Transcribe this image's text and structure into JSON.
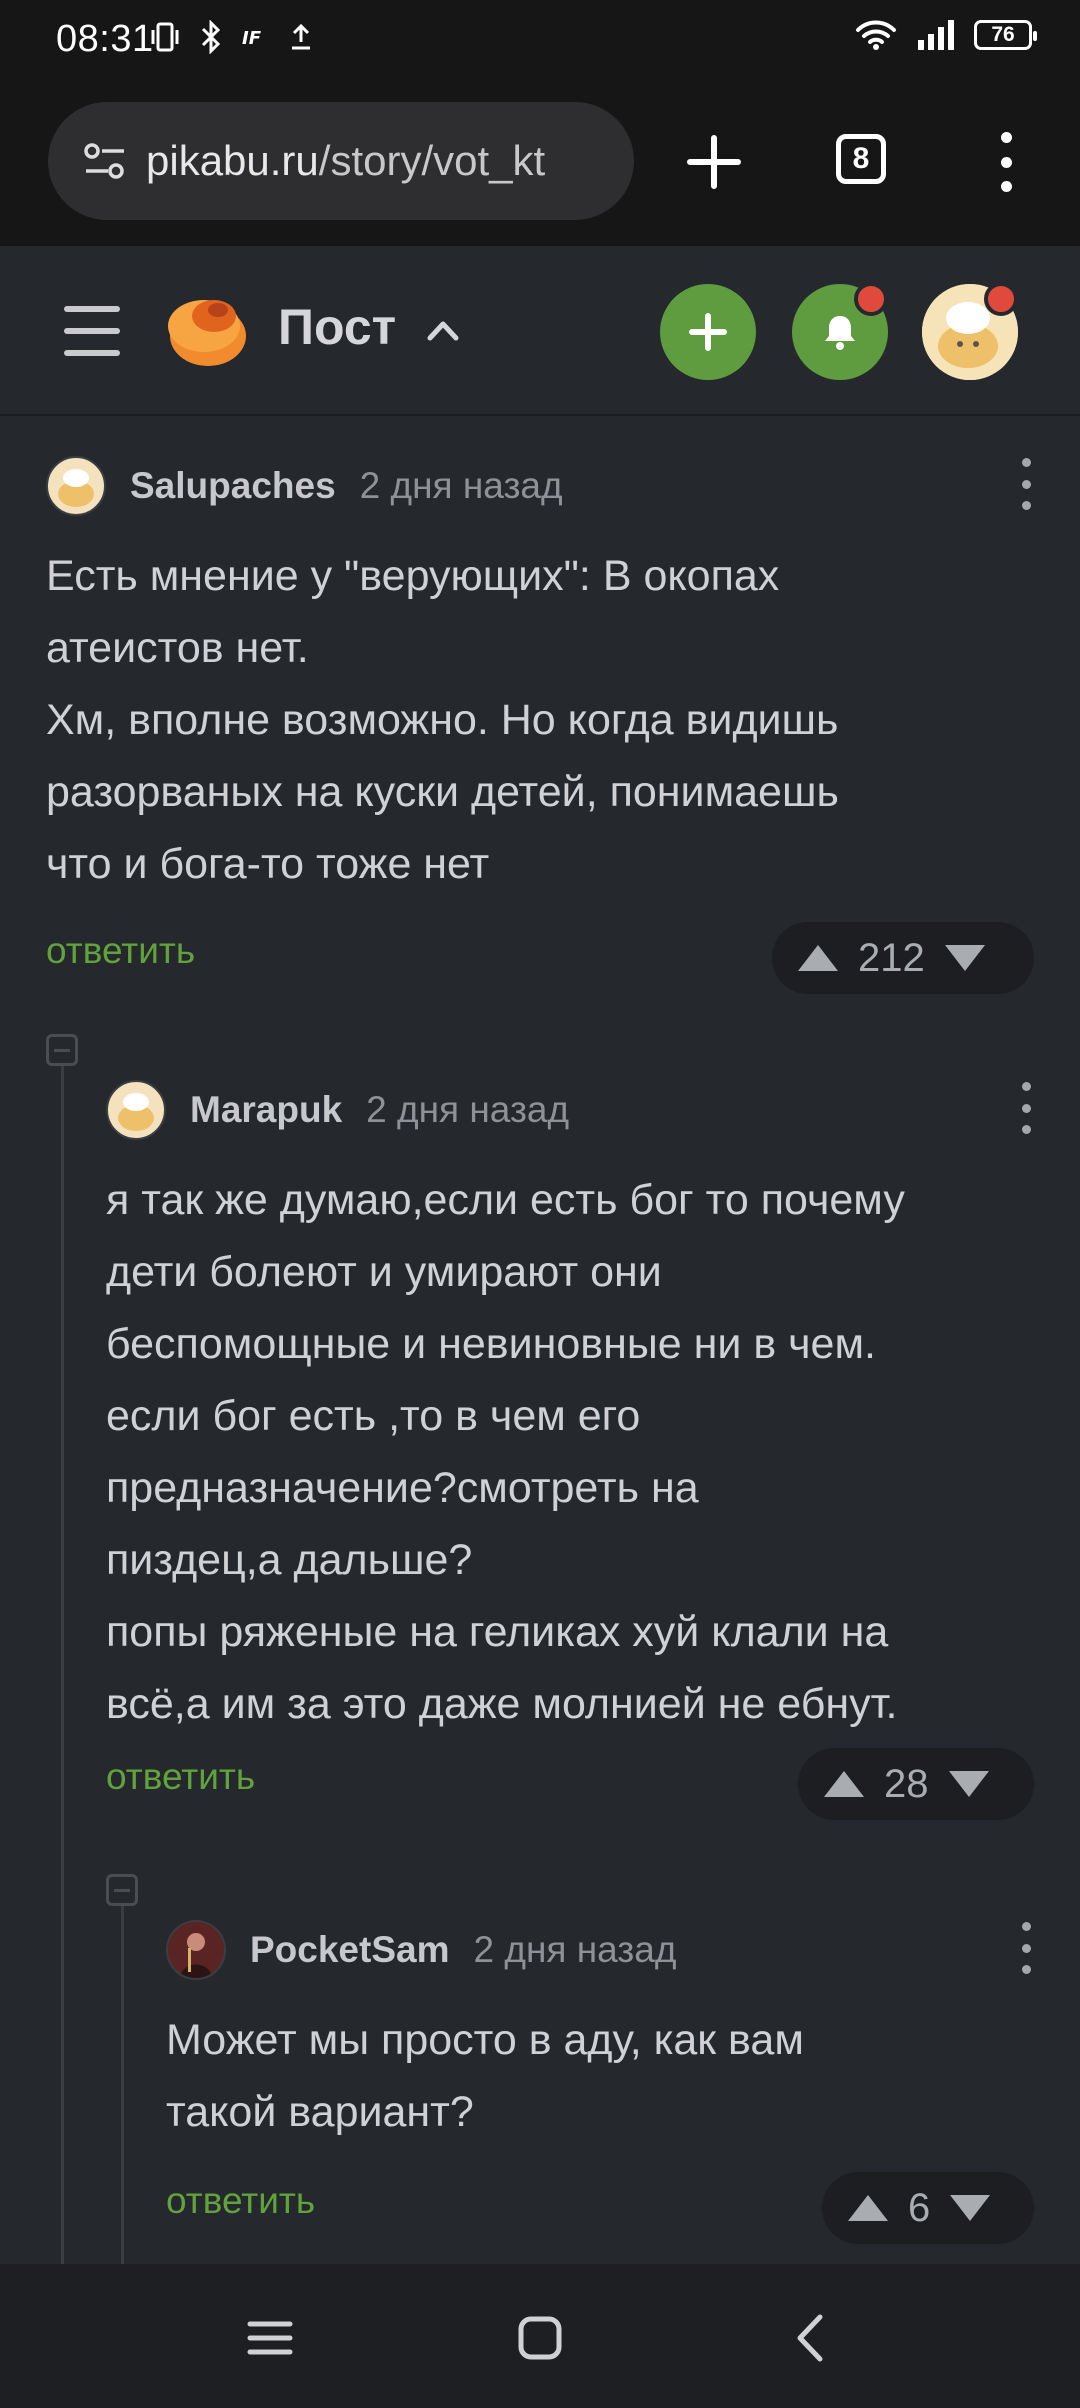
{
  "status_bar": {
    "time": "08:31",
    "battery": "76"
  },
  "browser": {
    "url_domain": "pikabu.ru",
    "url_path": "/story/vot_kt",
    "tab_count": "8"
  },
  "header": {
    "title": "Пост"
  },
  "comments": [
    {
      "author": "Salupaches",
      "time": "2 дня назад",
      "body": "Есть мнение у \"верующих\": В окопах\nатеистов нет.\nХм, вполне возможно. Но когда видишь\nразорваных на куски детей, понимаешь\nчто и бога-то тоже нет",
      "reply_label": "ответить",
      "rating": "212"
    },
    {
      "author": "Marapuk",
      "time": "2 дня назад",
      "body": "я так же думаю,если есть бог то почему\nдети болеют и умирают они\nбеспомощные и невиновные ни в чем.\nесли бог есть ,то в чем его\nпредназначение?смотреть на\nпиздец,а дальше?\nпопы ряженые на геликах хуй клали на\nвсё,а им за это даже молнией не ебнут.",
      "reply_label": "ответить",
      "rating": "28"
    },
    {
      "author": "PocketSam",
      "time": "2 дня назад",
      "body": "Может мы просто в аду, как вам\nтакой вариант?",
      "reply_label": "ответить",
      "rating": "6"
    }
  ],
  "colors": {
    "accent": "#5f9b3f",
    "reply_link": "#62a23c",
    "background": "#25282d",
    "notification": "#e04a3d"
  }
}
